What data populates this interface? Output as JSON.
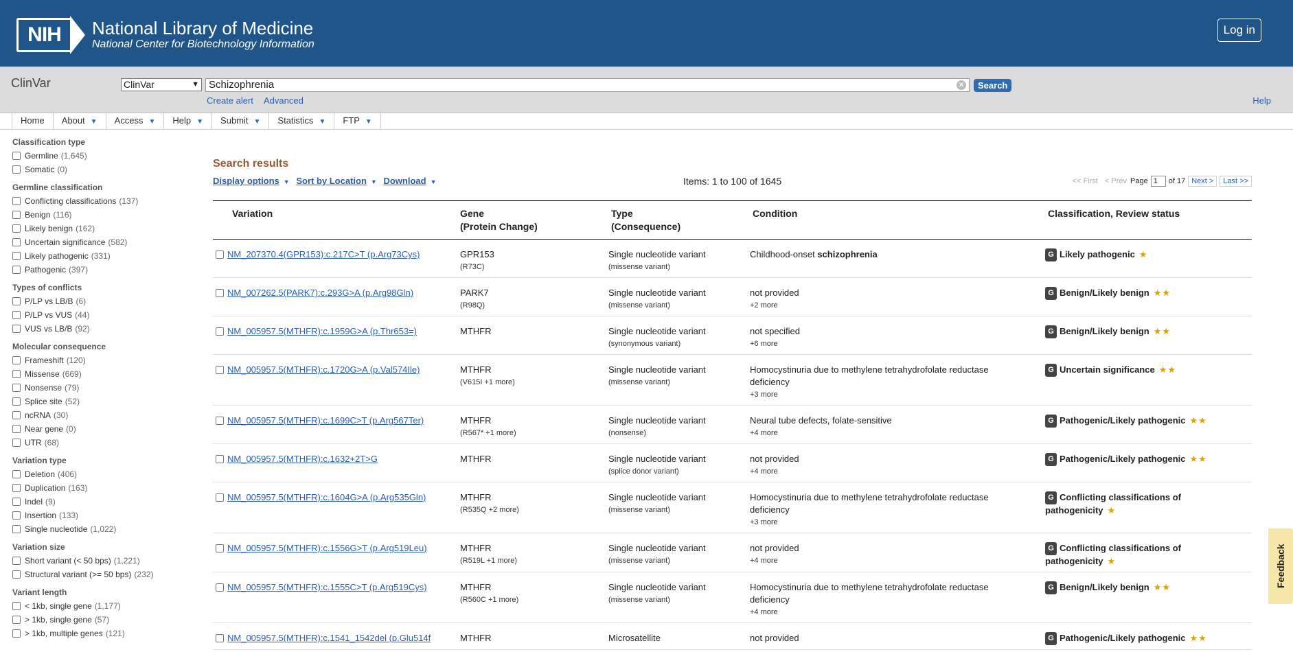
{
  "header": {
    "logo_abbr": "NIH",
    "title": "National Library of Medicine",
    "subtitle": "National Center for Biotechnology Information",
    "login_label": "Log in"
  },
  "search": {
    "db_label": "ClinVar",
    "db_select": "ClinVar",
    "query": "Schizophrenia",
    "button": "Search",
    "create_alert": "Create alert",
    "advanced": "Advanced",
    "help": "Help"
  },
  "nav": {
    "items": [
      "Home",
      "About",
      "Access",
      "Help",
      "Submit",
      "Statistics",
      "FTP"
    ]
  },
  "filters": [
    {
      "title": "Classification type",
      "items": [
        [
          "Germline",
          "(1,645)"
        ],
        [
          "Somatic",
          "(0)"
        ]
      ]
    },
    {
      "title": "Germline classification",
      "items": [
        [
          "Conflicting classifications",
          "(137)"
        ],
        [
          "Benign",
          "(116)"
        ],
        [
          "Likely benign",
          "(162)"
        ],
        [
          "Uncertain significance",
          "(582)"
        ],
        [
          "Likely pathogenic",
          "(331)"
        ],
        [
          "Pathogenic",
          "(397)"
        ]
      ]
    },
    {
      "title": "Types of conflicts",
      "items": [
        [
          "P/LP vs LB/B",
          "(6)"
        ],
        [
          "P/LP vs VUS",
          "(44)"
        ],
        [
          "VUS vs LB/B",
          "(92)"
        ]
      ]
    },
    {
      "title": "Molecular consequence",
      "items": [
        [
          "Frameshift",
          "(120)"
        ],
        [
          "Missense",
          "(669)"
        ],
        [
          "Nonsense",
          "(79)"
        ],
        [
          "Splice site",
          "(52)"
        ],
        [
          "ncRNA",
          "(30)"
        ],
        [
          "Near gene",
          "(0)"
        ],
        [
          "UTR",
          "(68)"
        ]
      ]
    },
    {
      "title": "Variation type",
      "items": [
        [
          "Deletion",
          "(406)"
        ],
        [
          "Duplication",
          "(163)"
        ],
        [
          "Indel",
          "(9)"
        ],
        [
          "Insertion",
          "(133)"
        ],
        [
          "Single nucleotide",
          "(1,022)"
        ]
      ]
    },
    {
      "title": "Variation size",
      "items": [
        [
          "Short variant (< 50 bps)",
          "(1,221)"
        ],
        [
          "Structural variant (>= 50 bps)",
          "(232)"
        ]
      ]
    },
    {
      "title": "Variant length",
      "items": [
        [
          "< 1kb, single gene",
          "(1,177)"
        ],
        [
          "> 1kb, single gene",
          "(57)"
        ],
        [
          "> 1kb, multiple genes",
          "(121)"
        ]
      ]
    }
  ],
  "results": {
    "title": "Search results",
    "display_options": "Display options",
    "sort": "Sort by Location",
    "download": "Download",
    "items_count": "Items: 1 to 100 of 1645",
    "pager": {
      "first": "<< First",
      "prev": "< Prev",
      "page_label": "Page",
      "page": "1",
      "of": "of 17",
      "next": "Next >",
      "last": "Last >>"
    },
    "columns": [
      "Variation",
      "Gene",
      "(Protein Change)",
      "Type",
      "(Consequence)",
      "Condition",
      "Classification, Review status"
    ],
    "rows": [
      {
        "variation": "NM_207370.4(GPR153):c.217C>T (p.Arg73Cys)",
        "gene": "GPR153",
        "protein": "(R73C)",
        "type": "Single nucleotide variant",
        "consequence": "(missense variant)",
        "condition": "Childhood-onset",
        "condition_bold": "schizophrenia",
        "condition_more": "",
        "classification": "Likely pathogenic",
        "stars": "★"
      },
      {
        "variation": "NM_007262.5(PARK7):c.293G>A (p.Arg98Gln)",
        "gene": "PARK7",
        "protein": "(R98Q)",
        "type": "Single nucleotide variant",
        "consequence": "(missense variant)",
        "condition": "not provided",
        "condition_bold": "",
        "condition_more": "+2 more",
        "classification": "Benign/Likely benign",
        "stars": "★★"
      },
      {
        "variation": "NM_005957.5(MTHFR):c.1959G>A (p.Thr653=)",
        "gene": "MTHFR",
        "protein": "",
        "type": "Single nucleotide variant",
        "consequence": "(synonymous variant)",
        "condition": "not specified",
        "condition_bold": "",
        "condition_more": "+6 more",
        "classification": "Benign/Likely benign",
        "stars": "★★"
      },
      {
        "variation": "NM_005957.5(MTHFR):c.1720G>A (p.Val574Ile)",
        "gene": "MTHFR",
        "protein": "(V615I +1 more)",
        "type": "Single nucleotide variant",
        "consequence": "(missense variant)",
        "condition": "Homocystinuria due to methylene tetrahydrofolate reductase deficiency",
        "condition_bold": "",
        "condition_more": "+3 more",
        "classification": "Uncertain significance",
        "stars": "★★"
      },
      {
        "variation": "NM_005957.5(MTHFR):c.1699C>T (p.Arg567Ter)",
        "gene": "MTHFR",
        "protein": "(R567* +1 more)",
        "type": "Single nucleotide variant",
        "consequence": "(nonsense)",
        "condition": "Neural tube defects, folate-sensitive",
        "condition_bold": "",
        "condition_more": "+4 more",
        "classification": "Pathogenic/Likely pathogenic",
        "stars": "★★"
      },
      {
        "variation": "NM_005957.5(MTHFR):c.1632+2T>G",
        "gene": "MTHFR",
        "protein": "",
        "type": "Single nucleotide variant",
        "consequence": "(splice donor variant)",
        "condition": "not provided",
        "condition_bold": "",
        "condition_more": "+4 more",
        "classification": "Pathogenic/Likely pathogenic",
        "stars": "★★"
      },
      {
        "variation": "NM_005957.5(MTHFR):c.1604G>A (p.Arg535Gln)",
        "gene": "MTHFR",
        "protein": "(R535Q +2 more)",
        "type": "Single nucleotide variant",
        "consequence": "(missense variant)",
        "condition": "Homocystinuria due to methylene tetrahydrofolate reductase deficiency",
        "condition_bold": "",
        "condition_more": "+3 more",
        "classification": "Conflicting classifications of pathogenicity",
        "stars": "★"
      },
      {
        "variation": "NM_005957.5(MTHFR):c.1556G>T (p.Arg519Leu)",
        "gene": "MTHFR",
        "protein": "(R519L +1 more)",
        "type": "Single nucleotide variant",
        "consequence": "(missense variant)",
        "condition": "not provided",
        "condition_bold": "",
        "condition_more": "+4 more",
        "classification": "Conflicting classifications of pathogenicity",
        "stars": "★"
      },
      {
        "variation": "NM_005957.5(MTHFR):c.1555C>T (p.Arg519Cys)",
        "gene": "MTHFR",
        "protein": "(R560C +1 more)",
        "type": "Single nucleotide variant",
        "consequence": "(missense variant)",
        "condition": "Homocystinuria due to methylene tetrahydrofolate reductase deficiency",
        "condition_bold": "",
        "condition_more": "+4 more",
        "classification": "Benign/Likely benign",
        "stars": "★★"
      },
      {
        "variation": "NM_005957.5(MTHFR):c.1541_1542del (p.Glu514f",
        "gene": "MTHFR",
        "protein": "",
        "type": "Microsatellite",
        "consequence": "",
        "condition": "not provided",
        "condition_bold": "",
        "condition_more": "",
        "classification": "Pathogenic/Likely pathogenic",
        "stars": "★★"
      }
    ]
  },
  "feedback": "Feedback",
  "colors": {
    "header_bg": "#20558a",
    "link": "#2a5db0",
    "results_title": "#985735",
    "star": "#d9a400"
  }
}
